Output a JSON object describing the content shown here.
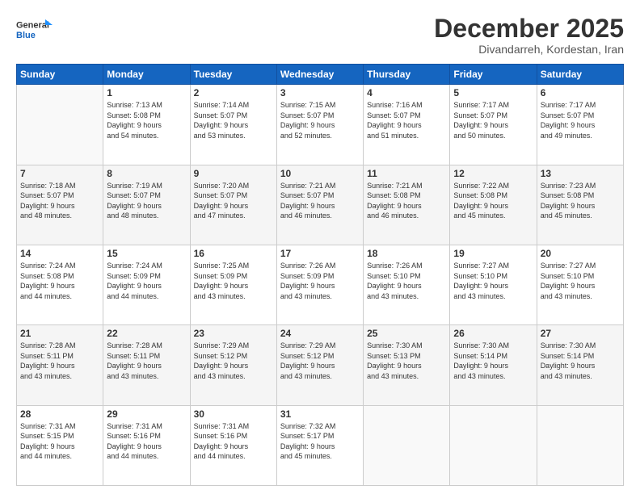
{
  "header": {
    "logo_general": "General",
    "logo_blue": "Blue",
    "month_title": "December 2025",
    "location": "Divandarreh, Kordestan, Iran"
  },
  "weekdays": [
    "Sunday",
    "Monday",
    "Tuesday",
    "Wednesday",
    "Thursday",
    "Friday",
    "Saturday"
  ],
  "weeks": [
    [
      {
        "day": "",
        "info": ""
      },
      {
        "day": "1",
        "info": "Sunrise: 7:13 AM\nSunset: 5:08 PM\nDaylight: 9 hours\nand 54 minutes."
      },
      {
        "day": "2",
        "info": "Sunrise: 7:14 AM\nSunset: 5:07 PM\nDaylight: 9 hours\nand 53 minutes."
      },
      {
        "day": "3",
        "info": "Sunrise: 7:15 AM\nSunset: 5:07 PM\nDaylight: 9 hours\nand 52 minutes."
      },
      {
        "day": "4",
        "info": "Sunrise: 7:16 AM\nSunset: 5:07 PM\nDaylight: 9 hours\nand 51 minutes."
      },
      {
        "day": "5",
        "info": "Sunrise: 7:17 AM\nSunset: 5:07 PM\nDaylight: 9 hours\nand 50 minutes."
      },
      {
        "day": "6",
        "info": "Sunrise: 7:17 AM\nSunset: 5:07 PM\nDaylight: 9 hours\nand 49 minutes."
      }
    ],
    [
      {
        "day": "7",
        "info": "Sunrise: 7:18 AM\nSunset: 5:07 PM\nDaylight: 9 hours\nand 48 minutes."
      },
      {
        "day": "8",
        "info": "Sunrise: 7:19 AM\nSunset: 5:07 PM\nDaylight: 9 hours\nand 48 minutes."
      },
      {
        "day": "9",
        "info": "Sunrise: 7:20 AM\nSunset: 5:07 PM\nDaylight: 9 hours\nand 47 minutes."
      },
      {
        "day": "10",
        "info": "Sunrise: 7:21 AM\nSunset: 5:07 PM\nDaylight: 9 hours\nand 46 minutes."
      },
      {
        "day": "11",
        "info": "Sunrise: 7:21 AM\nSunset: 5:08 PM\nDaylight: 9 hours\nand 46 minutes."
      },
      {
        "day": "12",
        "info": "Sunrise: 7:22 AM\nSunset: 5:08 PM\nDaylight: 9 hours\nand 45 minutes."
      },
      {
        "day": "13",
        "info": "Sunrise: 7:23 AM\nSunset: 5:08 PM\nDaylight: 9 hours\nand 45 minutes."
      }
    ],
    [
      {
        "day": "14",
        "info": "Sunrise: 7:24 AM\nSunset: 5:08 PM\nDaylight: 9 hours\nand 44 minutes."
      },
      {
        "day": "15",
        "info": "Sunrise: 7:24 AM\nSunset: 5:09 PM\nDaylight: 9 hours\nand 44 minutes."
      },
      {
        "day": "16",
        "info": "Sunrise: 7:25 AM\nSunset: 5:09 PM\nDaylight: 9 hours\nand 43 minutes."
      },
      {
        "day": "17",
        "info": "Sunrise: 7:26 AM\nSunset: 5:09 PM\nDaylight: 9 hours\nand 43 minutes."
      },
      {
        "day": "18",
        "info": "Sunrise: 7:26 AM\nSunset: 5:10 PM\nDaylight: 9 hours\nand 43 minutes."
      },
      {
        "day": "19",
        "info": "Sunrise: 7:27 AM\nSunset: 5:10 PM\nDaylight: 9 hours\nand 43 minutes."
      },
      {
        "day": "20",
        "info": "Sunrise: 7:27 AM\nSunset: 5:10 PM\nDaylight: 9 hours\nand 43 minutes."
      }
    ],
    [
      {
        "day": "21",
        "info": "Sunrise: 7:28 AM\nSunset: 5:11 PM\nDaylight: 9 hours\nand 43 minutes."
      },
      {
        "day": "22",
        "info": "Sunrise: 7:28 AM\nSunset: 5:11 PM\nDaylight: 9 hours\nand 43 minutes."
      },
      {
        "day": "23",
        "info": "Sunrise: 7:29 AM\nSunset: 5:12 PM\nDaylight: 9 hours\nand 43 minutes."
      },
      {
        "day": "24",
        "info": "Sunrise: 7:29 AM\nSunset: 5:12 PM\nDaylight: 9 hours\nand 43 minutes."
      },
      {
        "day": "25",
        "info": "Sunrise: 7:30 AM\nSunset: 5:13 PM\nDaylight: 9 hours\nand 43 minutes."
      },
      {
        "day": "26",
        "info": "Sunrise: 7:30 AM\nSunset: 5:14 PM\nDaylight: 9 hours\nand 43 minutes."
      },
      {
        "day": "27",
        "info": "Sunrise: 7:30 AM\nSunset: 5:14 PM\nDaylight: 9 hours\nand 43 minutes."
      }
    ],
    [
      {
        "day": "28",
        "info": "Sunrise: 7:31 AM\nSunset: 5:15 PM\nDaylight: 9 hours\nand 44 minutes."
      },
      {
        "day": "29",
        "info": "Sunrise: 7:31 AM\nSunset: 5:16 PM\nDaylight: 9 hours\nand 44 minutes."
      },
      {
        "day": "30",
        "info": "Sunrise: 7:31 AM\nSunset: 5:16 PM\nDaylight: 9 hours\nand 44 minutes."
      },
      {
        "day": "31",
        "info": "Sunrise: 7:32 AM\nSunset: 5:17 PM\nDaylight: 9 hours\nand 45 minutes."
      },
      {
        "day": "",
        "info": ""
      },
      {
        "day": "",
        "info": ""
      },
      {
        "day": "",
        "info": ""
      }
    ]
  ]
}
